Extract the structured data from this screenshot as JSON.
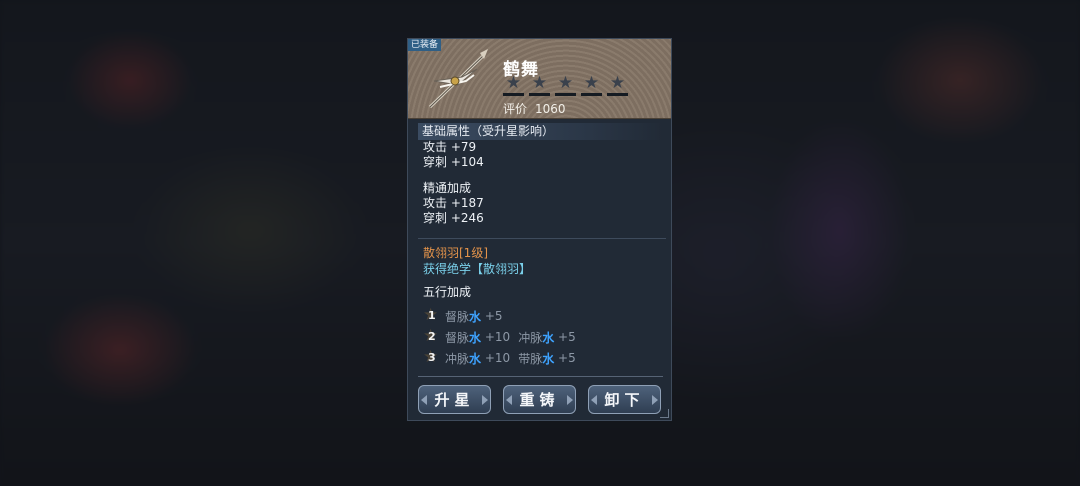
{
  "panel": {
    "equipped_tag": "已装备",
    "item_name": "鹤舞",
    "stars": [
      {
        "icon": "star-icon",
        "filled": false
      },
      {
        "icon": "star-icon",
        "filled": false
      },
      {
        "icon": "star-icon",
        "filled": false
      },
      {
        "icon": "star-icon",
        "filled": false
      },
      {
        "icon": "star-icon",
        "filled": false
      }
    ],
    "star_glyph": "★",
    "rating_label": "评价",
    "rating_value": "1060"
  },
  "base_attrs": {
    "header": "基础属性（受升星影响）",
    "lines": [
      "攻击 +79",
      "穿刺 +104"
    ]
  },
  "mastery": {
    "header": "精通加成",
    "lines": [
      "攻击 +187",
      "穿刺 +246"
    ]
  },
  "skill": {
    "name": "散翎羽[1级]",
    "gain": "获得绝学【散翎羽】"
  },
  "five_elements": {
    "header": "五行加成",
    "star_glyph": "★",
    "rows": [
      {
        "level": "1",
        "items": [
          {
            "meridian": "督脉",
            "element": "水",
            "bonus": "+5"
          }
        ]
      },
      {
        "level": "2",
        "items": [
          {
            "meridian": "督脉",
            "element": "水",
            "bonus": "+10"
          },
          {
            "meridian": "冲脉",
            "element": "水",
            "bonus": "+5"
          }
        ]
      },
      {
        "level": "3",
        "items": [
          {
            "meridian": "冲脉",
            "element": "水",
            "bonus": "+10"
          },
          {
            "meridian": "带脉",
            "element": "水",
            "bonus": "+5"
          }
        ]
      }
    ]
  },
  "buttons": {
    "upgrade_star": "升星",
    "reforge": "重铸",
    "unequip": "卸下"
  },
  "colors": {
    "skill_name": "#e3934a",
    "skill_gain": "#7ad0ea",
    "water_element": "#3ea3ff"
  }
}
